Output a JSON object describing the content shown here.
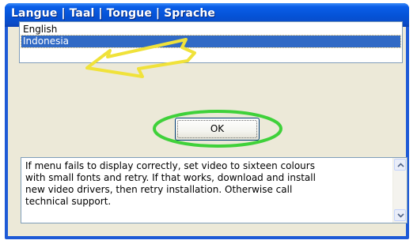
{
  "window": {
    "title": "Langue | Taal | Tongue | Sprache"
  },
  "language_list": {
    "items": [
      {
        "label": "English",
        "selected": false
      },
      {
        "label": "Indonesia",
        "selected": true
      }
    ]
  },
  "ok_button": {
    "label": "OK"
  },
  "message": {
    "lines": [
      "If menu fails to display correctly, set video to sixteen colours",
      "with small fonts and retry. If that works, download and install",
      "new video drivers, then retry installation. Otherwise call",
      "technical support."
    ]
  },
  "annotations": {
    "arrow_color": "#f0e23a",
    "ellipse_color": "#3fd13a"
  },
  "colors": {
    "title_bar": "#0552d6",
    "selection": "#316ac5",
    "dialog_face": "#ece9d8"
  }
}
